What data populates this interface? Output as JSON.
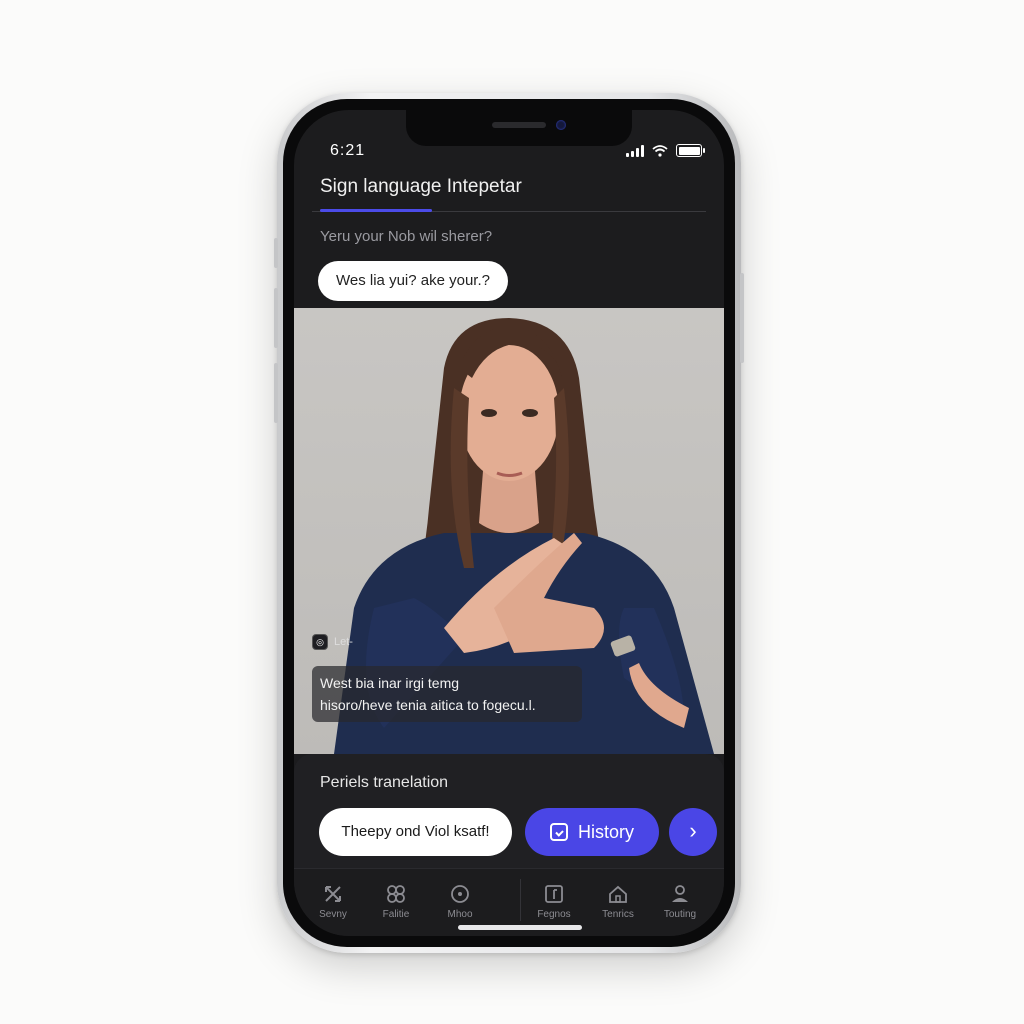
{
  "status_bar": {
    "time": "6:21"
  },
  "header": {
    "title": "Sign language Intepetar"
  },
  "prompt": {
    "label": "Yeru your Nob wil sherer?",
    "query": "Wes lia yui? ake your.?"
  },
  "video": {
    "live_label": "Let-",
    "caption_lines": [
      "West bia inar irgi temg",
      "hisoro/heve tenia aitica to fogecu.l."
    ]
  },
  "panel": {
    "label": "Periels tranelation",
    "translation_text": "Theepy ond Viol ksatf!",
    "history_label": "History",
    "next_glyph": "›"
  },
  "tabs": [
    {
      "label": "Sevny",
      "icon": "cross-arrows-icon"
    },
    {
      "label": "Falitie",
      "icon": "butterfly-icon"
    },
    {
      "label": "Mhoo",
      "icon": "circle-dot-icon"
    },
    {
      "label": "Fegnos",
      "icon": "flag-box-icon"
    },
    {
      "label": "Tenrics",
      "icon": "home-icon"
    },
    {
      "label": "Touting",
      "icon": "person-icon"
    }
  ],
  "colors": {
    "accent": "#4a46e6",
    "screen_bg": "#1c1c1e",
    "panel_bg": "#202023"
  }
}
